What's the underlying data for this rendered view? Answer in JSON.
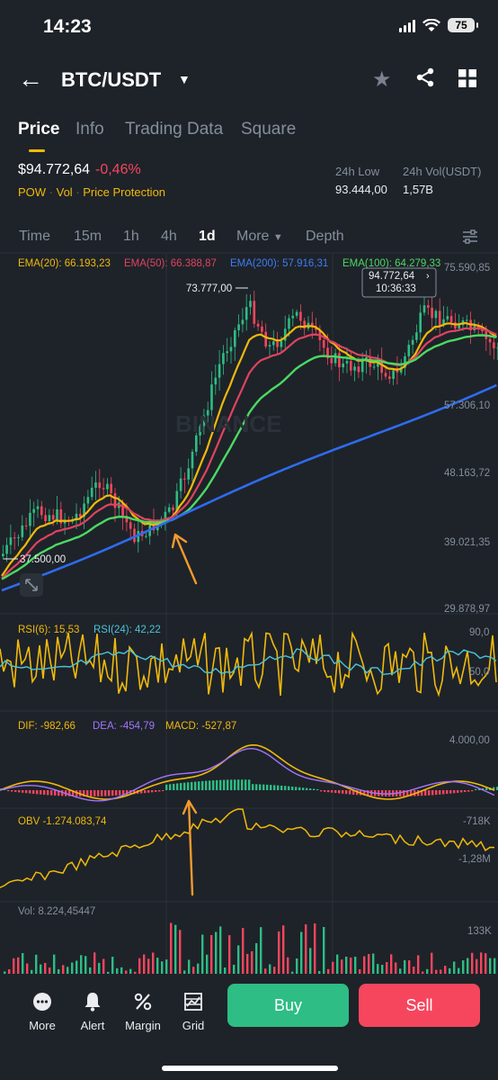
{
  "status": {
    "time": "14:23",
    "battery": "75"
  },
  "header": {
    "title": "BTC/USDT"
  },
  "tabs": [
    {
      "label": "Price"
    },
    {
      "label": "Info"
    },
    {
      "label": "Trading Data"
    },
    {
      "label": "Square"
    }
  ],
  "ticker": {
    "price": "$94.772,64",
    "change": "-0,46%",
    "tag_pow": "POW",
    "tag_vol": "Vol",
    "tag_protection": "Price Protection",
    "low_label": "24h Low",
    "low_value": "93.444,00",
    "vol_label": "24h Vol(USDT)",
    "vol_value": "1,57B"
  },
  "timeframes": {
    "time": "Time",
    "m15": "15m",
    "h1": "1h",
    "h4": "4h",
    "d1": "1d",
    "more": "More",
    "depth": "Depth"
  },
  "ema_legend": {
    "ema20": "EMA(20): 66.193,23",
    "ema50": "EMA(50): 66.388,87",
    "ema200": "EMA(200): 57.916,31",
    "ema100": "EMA(100): 64.279,33"
  },
  "price_axis": [
    "75.590,85",
    "57.306,10",
    "48.163,72",
    "39.021,35",
    "29.878,97"
  ],
  "annotations": {
    "high_label": "73.777,00",
    "low_label": "37.500,00",
    "tooltip_price": "94.772,64",
    "tooltip_time": "10:36:33",
    "watermark": "BINANCE"
  },
  "rsi": {
    "rsi6": "RSI(6): 15,53",
    "rsi24": "RSI(24): 42,22",
    "axis_top": "90,0",
    "axis_mid": "50,0"
  },
  "macd": {
    "dif": "DIF: -982,66",
    "dea": "DEA: -454,79",
    "macd": "MACD: -527,87",
    "axis_top": "4.000,00"
  },
  "obv": {
    "label": "OBV -1.274.083,74",
    "axis_top": "-718K",
    "axis_mid": "-1,28M"
  },
  "volume": {
    "label": "Vol: 8.224,45447",
    "axis_top": "133K"
  },
  "colors": {
    "up": "#2ebd85",
    "down": "#f6465d",
    "ema20": "#f0b90b",
    "ema50": "#e0435f",
    "ema100": "#4cd964",
    "ema200": "#2f6bef",
    "accent": "#f0b90b"
  },
  "bottom_nav": {
    "more": "More",
    "alert": "Alert",
    "margin": "Margin",
    "grid": "Grid",
    "buy": "Buy",
    "sell": "Sell"
  }
}
